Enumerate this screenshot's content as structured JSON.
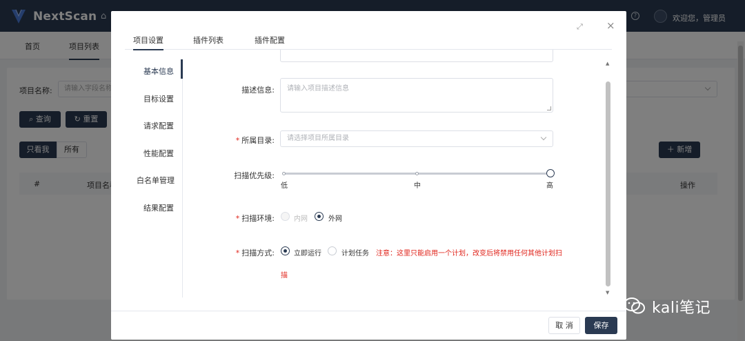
{
  "app": {
    "brand": "NextScan",
    "welcome": "欢迎您，管理员",
    "tabs": [
      "首页",
      "项目列表"
    ],
    "search": {
      "name_label": "项目名称:",
      "name_placeholder": "请输入字段名称",
      "query_label": "查询",
      "reset_label": "重置"
    },
    "filters": [
      "只看我",
      "所有"
    ],
    "add_label": "新增",
    "table_headers": [
      "#",
      "项目名称",
      "操作"
    ]
  },
  "modal": {
    "tabs": [
      "项目设置",
      "插件列表",
      "插件配置"
    ],
    "side_nav": [
      "基本信息",
      "目标设置",
      "请求配置",
      "性能配置",
      "白名单管理",
      "结果配置"
    ],
    "desc": {
      "label": "描述信息:",
      "placeholder": "请输入项目描述信息"
    },
    "dir": {
      "label": "所属目录:",
      "placeholder": "请选择项目所属目录"
    },
    "priority": {
      "label": "扫描优先级:",
      "ticks": [
        "低",
        "中",
        "高"
      ],
      "value": "高"
    },
    "env": {
      "label": "扫描环境:",
      "options": [
        "内网",
        "外网"
      ],
      "selected": "外网"
    },
    "mode": {
      "label": "扫描方式:",
      "options": [
        "立即运行",
        "计划任务"
      ],
      "selected": "立即运行",
      "note": "注意：这里只能启用一个计划，改变后将禁用任何其他计划扫",
      "note_cont": "描"
    },
    "footer": {
      "cancel": "取 消",
      "save": "保存"
    }
  },
  "watermark": "kali笔记",
  "colors": {
    "primary": "#2a3a52",
    "danger": "#e0241b"
  }
}
